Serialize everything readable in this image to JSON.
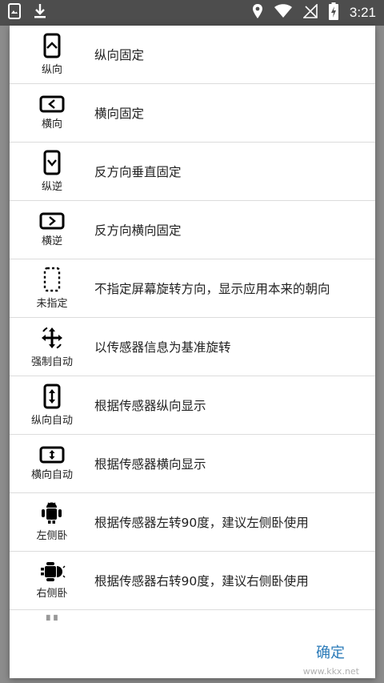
{
  "status_bar": {
    "time": "3:21",
    "left_icons": [
      "screenshot-icon",
      "download-icon"
    ],
    "right_icons": [
      "location-icon",
      "wifi-icon",
      "no-signal-icon",
      "battery-charging-icon"
    ]
  },
  "options": [
    {
      "icon": "portrait-icon",
      "label": "纵向",
      "text": "纵向固定"
    },
    {
      "icon": "landscape-icon",
      "label": "横向",
      "text": "横向固定"
    },
    {
      "icon": "reverse-portrait-icon",
      "label": "纵逆",
      "text": "反方向垂直固定"
    },
    {
      "icon": "reverse-landscape-icon",
      "label": "横逆",
      "text": "反方向横向固定"
    },
    {
      "icon": "unspecified-icon",
      "label": "未指定",
      "text": "不指定屏幕旋转方向，显示应用本来的朝向"
    },
    {
      "icon": "force-auto-icon",
      "label": "强制自动",
      "text": "以传感器信息为基准旋转"
    },
    {
      "icon": "portrait-auto-icon",
      "label": "纵向自动",
      "text": "根据传感器纵向显示"
    },
    {
      "icon": "landscape-auto-icon",
      "label": "横向自动",
      "text": "根据传感器横向显示"
    },
    {
      "icon": "left-lying-icon",
      "label": "左侧卧",
      "text": "根据传感器左转90度，建议左侧卧使用"
    },
    {
      "icon": "right-lying-icon",
      "label": "右侧卧",
      "text": "根据传感器右转90度，建议右侧卧使用"
    }
  ],
  "confirm_label": "确定",
  "watermark": "www.kkx.net"
}
